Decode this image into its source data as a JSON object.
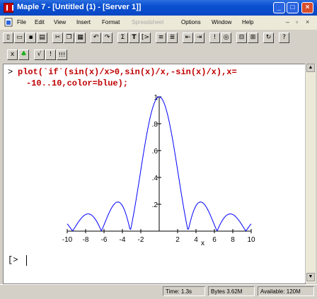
{
  "window": {
    "title": "Maple 7 - [Untitled (1) - [Server 1]]"
  },
  "menu": [
    "File",
    "Edit",
    "View",
    "Insert",
    "Format",
    "Spreadsheet",
    "Options",
    "Window",
    "Help"
  ],
  "toolbar": {
    "row1": [
      "new",
      "open",
      "save",
      "print",
      "cut",
      "copy",
      "paste",
      "undo",
      "redo",
      "sigma",
      "T",
      "insert-math",
      "insert-group",
      "sub",
      "enter",
      "restart",
      "zoom"
    ],
    "row2": [
      "x-symbol",
      "maple-leaf",
      "v-toggle",
      "exclaim",
      "triple-exclaim"
    ]
  },
  "worksheet": {
    "command_line1": "plot(`if`(sin(x)/x>0,sin(x)/x,-sin(x)/x),x=",
    "command_line2": "-10..10,color=blue);",
    "prompt_symbol": ">",
    "empty_prompt": "[>"
  },
  "chart_data": {
    "type": "line",
    "function": "abs(sin(x)/x)",
    "xlabel": "x",
    "xlim": [
      -10,
      10
    ],
    "ylim": [
      0,
      1
    ],
    "x_ticks": [
      "-10",
      "-8",
      "-6",
      "-4",
      "-2",
      "2",
      "4",
      "6",
      "8",
      "10"
    ],
    "y_ticks": [
      "1",
      ".8",
      ".6",
      ".4",
      ".2"
    ],
    "color": "#0000ff",
    "series": [
      {
        "x_range": [
          -10,
          10
        ],
        "samples": 200
      }
    ]
  },
  "status": {
    "time": "Time:  1.3s",
    "bytes": "Bytes  3.62M",
    "available": "Available: 120M"
  },
  "colors": {
    "title_bar": "#0a4fd0",
    "command": "#c00000",
    "plot_line": "#0000ff"
  }
}
